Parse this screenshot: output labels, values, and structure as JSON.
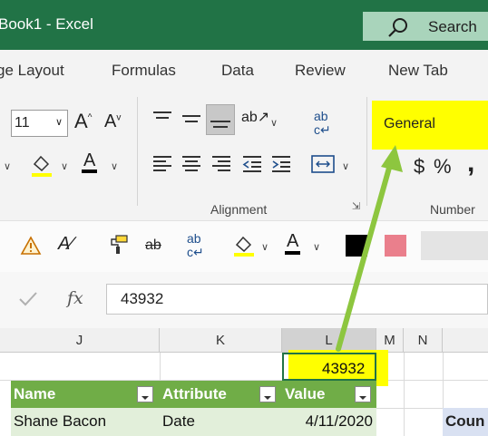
{
  "window": {
    "title": "Book1  -  Excel"
  },
  "search": {
    "label": "Search"
  },
  "tabs": [
    {
      "label": "ge Layout"
    },
    {
      "label": "Formulas"
    },
    {
      "label": "Data"
    },
    {
      "label": "Review"
    },
    {
      "label": "New Tab"
    }
  ],
  "ribbon": {
    "font_size": "11",
    "alignment_label": "Alignment",
    "number_label": "Number",
    "number_format": "General",
    "currency_symbol": "$",
    "percent_symbol": "%",
    "comma_symbol": ","
  },
  "formula_bar": {
    "fx_label": "fx",
    "value": "43932"
  },
  "columns": [
    "J",
    "K",
    "L",
    "M",
    "N"
  ],
  "cells": {
    "L1": "43932"
  },
  "table": {
    "headers": [
      "Name",
      "Attribute",
      "Value"
    ],
    "rows": [
      [
        "Shane Bacon",
        "Date",
        "4/11/2020"
      ]
    ],
    "next_header": "Coun"
  },
  "colors": {
    "excel_green": "#217346",
    "highlight_yellow": "#ffff00",
    "arrow_green": "#8dc63f",
    "table_header": "#70ad47",
    "table_row": "#e2efda"
  }
}
